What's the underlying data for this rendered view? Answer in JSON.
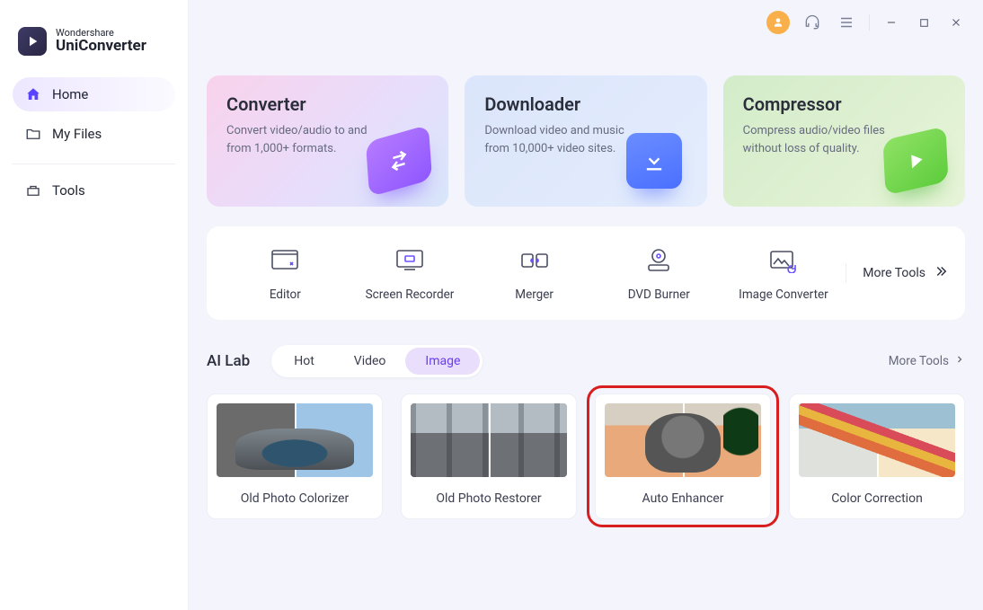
{
  "brand": {
    "top": "Wondershare",
    "bottom": "UniConverter"
  },
  "sidebar": {
    "items": [
      {
        "label": "Home"
      },
      {
        "label": "My Files"
      },
      {
        "label": "Tools"
      }
    ]
  },
  "cards": {
    "converter": {
      "title": "Converter",
      "desc": "Convert video/audio to and from 1,000+ formats."
    },
    "downloader": {
      "title": "Downloader",
      "desc": "Download video and music from 10,000+ video sites."
    },
    "compressor": {
      "title": "Compressor",
      "desc": "Compress audio/video files without loss of quality."
    }
  },
  "toolsStrip": {
    "items": [
      {
        "label": "Editor"
      },
      {
        "label": "Screen Recorder"
      },
      {
        "label": "Merger"
      },
      {
        "label": "DVD Burner"
      },
      {
        "label": "Image Converter"
      }
    ],
    "more": "More Tools"
  },
  "aiLab": {
    "title": "AI Lab",
    "tabs": [
      {
        "label": "Hot"
      },
      {
        "label": "Video"
      },
      {
        "label": "Image"
      }
    ],
    "more": "More Tools",
    "items": [
      {
        "label": "Old Photo Colorizer"
      },
      {
        "label": "Old Photo Restorer"
      },
      {
        "label": "Auto Enhancer"
      },
      {
        "label": "Color Correction"
      }
    ]
  }
}
